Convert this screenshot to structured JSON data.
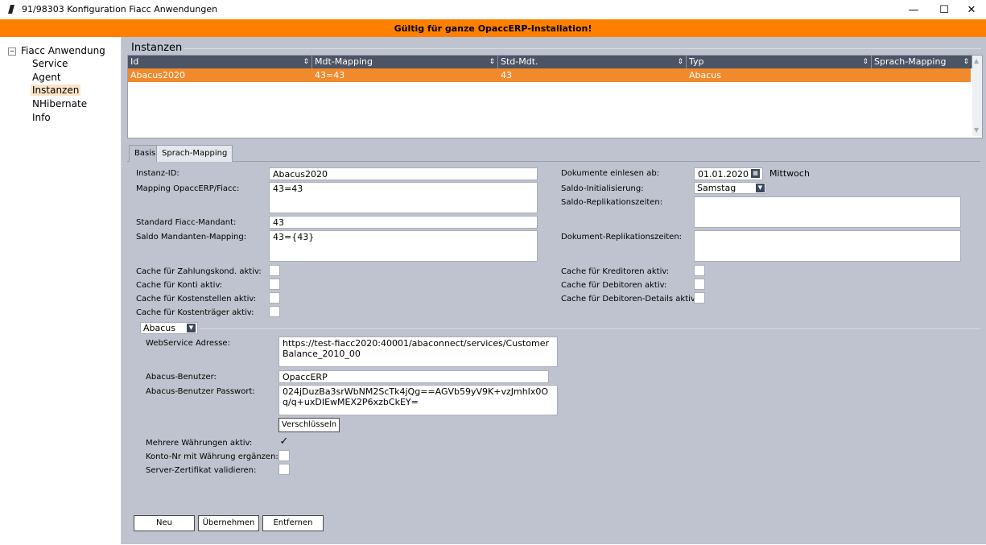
{
  "window": {
    "title": "91/98303 Konfiguration Fiacc Anwendungen",
    "minimize_icon": "minimize-icon",
    "maximize_icon": "maximize-icon",
    "close_icon": "close-icon"
  },
  "banner": {
    "text": "Gültig für ganze OpaccERP-Installation!",
    "color": "#ff8000"
  },
  "tree": {
    "root_label": "Fiacc Anwendung",
    "toggle_symbol": "−",
    "items": [
      {
        "label": "Service"
      },
      {
        "label": "Agent"
      },
      {
        "label": "Instanzen",
        "selected": true
      },
      {
        "label": "NHibernate"
      },
      {
        "label": "Info"
      }
    ]
  },
  "instances": {
    "group_label": "Instanzen",
    "columns": [
      "Id",
      "Mdt-Mapping",
      "Std-Mdt.",
      "Typ",
      "Sprach-Mapping"
    ],
    "rows": [
      {
        "id": "Abacus2020",
        "mdt_mapping": "43=43",
        "std_mdt": "43",
        "typ": "Abacus",
        "sprach_mapping": ""
      }
    ],
    "selected_row_color": "#f08a2c",
    "header_color": "#4b5566"
  },
  "tabs": [
    {
      "label": "Basis",
      "active": true
    },
    {
      "label": "Sprach-Mapping",
      "active": false
    }
  ],
  "form": {
    "instanz_id": {
      "label": "Instanz-ID:",
      "value": "Abacus2020"
    },
    "mapping": {
      "label": "Mapping OpaccERP/Fiacc:",
      "value": "43=43"
    },
    "standard_mandant": {
      "label": "Standard Fiacc-Mandant:",
      "value": "43"
    },
    "saldo_mapping": {
      "label": "Saldo Mandanten-Mapping:",
      "value": "43={43}"
    },
    "left_checks": [
      {
        "label": "Cache für Zahlungskond. aktiv:",
        "checked": false
      },
      {
        "label": "Cache für Konti aktiv:",
        "checked": false
      },
      {
        "label": "Cache für Kostenstellen aktiv:",
        "checked": false
      },
      {
        "label": "Cache für Kostenträger aktiv:",
        "checked": false
      }
    ],
    "dokumente_ab": {
      "label": "Dokumente einlesen ab:",
      "value": "01.01.2020",
      "weekday": "Mittwoch"
    },
    "saldo_init": {
      "label": "Saldo-Initialisierung:",
      "value": "Samstag"
    },
    "saldo_repl": {
      "label": "Saldo-Replikationszeiten:",
      "value": ""
    },
    "dok_repl": {
      "label": "Dokument-Replikationszeiten:",
      "value": ""
    },
    "right_checks": [
      {
        "label": "Cache für Kreditoren aktiv:",
        "checked": false
      },
      {
        "label": "Cache für Debitoren aktiv:",
        "checked": false
      },
      {
        "label": "Cache für Debitoren-Details aktiv:",
        "checked": false
      }
    ]
  },
  "abacus": {
    "type_select": "Abacus",
    "webservice": {
      "label": "WebService Adresse:",
      "value": "https://test-fiacc2020:40001/abaconnect/services/CustomerBalance_2010_00"
    },
    "user": {
      "label": "Abacus-Benutzer:",
      "value": "OpaccERP"
    },
    "password": {
      "label": "Abacus-Benutzer Passwort:",
      "value": "024jDuzBa3srWbNM2ScTk4jQg==AGVb59yV9K+vzJmhIx0Oq/q+uxDIEwMEX2P6xzbCkEY="
    },
    "encrypt_button": "Verschlüsseln",
    "checks": [
      {
        "label": "Mehrere Währungen aktiv:",
        "checked": true,
        "mark": "✓"
      },
      {
        "label": "Konto-Nr mit Währung ergänzen:",
        "checked": false,
        "mark": ""
      },
      {
        "label": "Server-Zertifikat validieren:",
        "checked": false,
        "mark": ""
      }
    ]
  },
  "buttons": {
    "new": "Neu",
    "apply": "Übernehmen",
    "remove": "Entfernen"
  }
}
